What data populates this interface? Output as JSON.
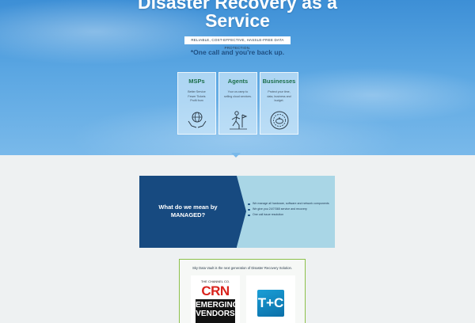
{
  "hero": {
    "title_line1": "Disaster Recovery as a",
    "title_line2": "Service",
    "tagline": "RELIABLE, COST-EFFECTIVE, HASSLE-FREE DATA PROTECTION.",
    "callout": "*One call and you're back up."
  },
  "cards": [
    {
      "title": "MSPs",
      "desc_lines": [
        "Better Service",
        "Fewer Tickets",
        "Profit from"
      ],
      "icon": "globe-hands-icon"
    },
    {
      "title": "Agents",
      "desc_lines": [
        "Your on-ramp to",
        "selling cloud services."
      ],
      "icon": "walker-flag-icon"
    },
    {
      "title": "Businesses",
      "desc_lines": [
        "Protect your time,",
        "data, business and",
        "budget."
      ],
      "icon": "piggy-bank-circle-icon"
    }
  ],
  "managed": {
    "title": "What do we mean by MANAGED?",
    "points": [
      "We manage all hardware, software and network components",
      "We give you 24/7/365 service and recovery",
      "One call issue resolution"
    ]
  },
  "awards": {
    "text": "Sky Data Vault is the next generation of Disaster Recovery Solution.",
    "crn_small": "THE CHANNEL CO.",
    "crn_big": "CRN",
    "crn_line1": "EMERGING",
    "crn_line2": "VENDORS",
    "tc_logo": "T+C"
  },
  "colors": {
    "card_title": "#1b6e4a",
    "managed_dark": "#174a80",
    "managed_light": "#a9d6e6",
    "award_border": "#8cc04a",
    "crn_red": "#d9231d"
  }
}
